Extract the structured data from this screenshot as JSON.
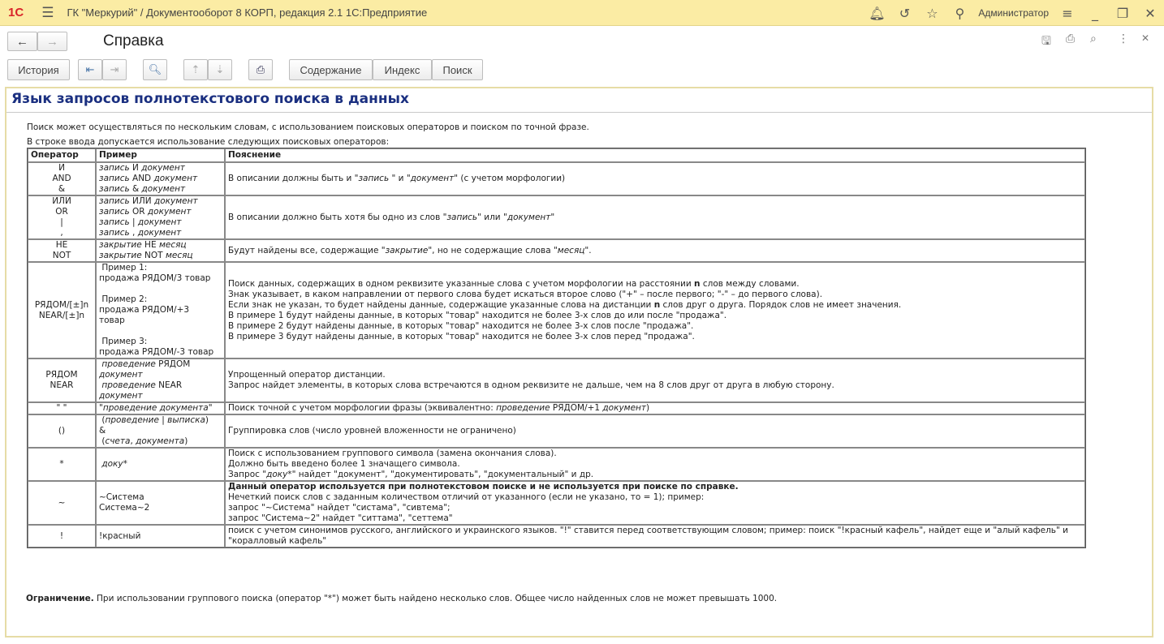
{
  "app": {
    "title": "ГК \"Меркурий\" / Документооборот 8 КОРП, редакция 2.1 1С:Предприятие",
    "logo": "1С",
    "user": "Администратор"
  },
  "window": {
    "title": "Справка"
  },
  "toolbar": {
    "history": "История",
    "contents": "Содержание",
    "index": "Индекс",
    "search": "Поиск"
  },
  "help": {
    "heading": "Язык запросов полнотекстового поиска в данных",
    "intro1": "Поиск может осуществляться по нескольким словам, с использованием поисковых операторов и поиском по точной фразе.",
    "intro2": "В строке ввода допускается использование следующих поисковых операторов:",
    "columns": [
      "Оператор",
      "Пример",
      "Пояснение"
    ],
    "rows": [
      {
        "op": [
          "И",
          "AND",
          "&"
        ],
        "ex": [
          [
            [
              "запись",
              "i"
            ],
            " И ",
            [
              "документ",
              "i"
            ]
          ],
          [
            [
              "запись",
              "i"
            ],
            " AND ",
            [
              "документ",
              "i"
            ]
          ],
          [
            [
              "запись",
              "i"
            ],
            " & ",
            [
              "документ",
              "i"
            ]
          ]
        ],
        "desc": [
          [
            "В описании должны быть и \"",
            [
              "запись ",
              "i"
            ],
            "\" и \"",
            [
              "документ",
              "i"
            ],
            "\" (с учетом морфологии)"
          ]
        ]
      },
      {
        "op": [
          "ИЛИ",
          "OR",
          "|",
          ","
        ],
        "ex": [
          [
            [
              "запись",
              "i"
            ],
            " ИЛИ ",
            [
              "документ",
              "i"
            ]
          ],
          [
            [
              "запись",
              "i"
            ],
            " OR ",
            [
              "документ",
              "i"
            ]
          ],
          [
            [
              "запись",
              "i"
            ],
            " | ",
            [
              "документ",
              "i"
            ]
          ],
          [
            [
              "запись",
              "i"
            ],
            " , ",
            [
              "документ",
              "i"
            ]
          ]
        ],
        "desc": [
          [
            "В описании должно быть хотя бы одно из слов \"",
            [
              "запись",
              "i"
            ],
            "\" или \"",
            [
              "документ",
              "i"
            ],
            "\""
          ]
        ]
      },
      {
        "op": [
          "НЕ",
          "NOT"
        ],
        "ex": [
          [
            [
              "закрытие",
              "i"
            ],
            " НЕ ",
            [
              "месяц",
              "i"
            ]
          ],
          [
            [
              "закрытие",
              "i"
            ],
            " NOT ",
            [
              "месяц",
              "i"
            ]
          ]
        ],
        "desc": [
          [
            "Будут найдены все, содержащие \"",
            [
              "закрытие",
              "i"
            ],
            "\", но не содержащие слова \"",
            [
              "месяц",
              "i"
            ],
            "\"."
          ]
        ]
      },
      {
        "op": [
          "РЯДОМ/[±]n",
          "NEAR/[±]n"
        ],
        "ex": [
          [
            " Пример 1:"
          ],
          [
            "продажа РЯДОМ/3 товар"
          ],
          [
            " "
          ],
          [
            " Пример 2:"
          ],
          [
            "продажа РЯДОМ/+3"
          ],
          [
            "товар"
          ],
          [
            " "
          ],
          [
            " Пример 3:"
          ],
          [
            "продажа РЯДОМ/-3 товар"
          ]
        ],
        "desc": [
          [
            "Поиск данных, содержащих в одном реквизите указанные слова с учетом морфологии на расстоянии ",
            [
              "n",
              "b"
            ],
            " слов между словами."
          ],
          [
            "Знак указывает, в каком направлении от первого слова будет искаться второе слово (\"+\" – после первого; \"-\" – до первого слова)."
          ],
          [
            "Если знак не указан, то будет найдены данные, содержащие указанные слова на дистанции ",
            [
              "n",
              "b"
            ],
            " слов друг о друга. Порядок слов не имеет значения."
          ],
          [
            "В примере 1 будут найдены данные, в которых \"товар\" находится не более 3-х слов до или после \"продажа\"."
          ],
          [
            "В примере 2 будут найдены данные, в которых \"товар\" находится не более 3-х слов после \"продажа\"."
          ],
          [
            "В примере 3 будут найдены данные, в которых \"товар\" находится не более 3-х слов перед \"продажа\"."
          ]
        ]
      },
      {
        "op": [
          "РЯДОМ",
          "NEAR"
        ],
        "ex": [
          [
            " ",
            [
              "проведение",
              "i"
            ],
            " РЯДОМ"
          ],
          [
            [
              "документ",
              "i"
            ]
          ],
          [
            " ",
            [
              "проведение",
              "i"
            ],
            " NEAR"
          ],
          [
            [
              "документ",
              "i"
            ]
          ]
        ],
        "desc": [
          [
            "Упрощенный оператор дистанции."
          ],
          [
            "Запрос найдет элементы, в которых слова встречаются в одном реквизите не дальше, чем на 8 слов друг от друга в любую сторону."
          ]
        ]
      },
      {
        "op": [
          "\" \""
        ],
        "ex": [
          [
            "\"",
            [
              "проведение документа",
              "i"
            ],
            "\""
          ]
        ],
        "desc": [
          [
            "Поиск точной с учетом морфологии фразы (эквивалентно: ",
            [
              "проведение",
              "i"
            ],
            " РЯДОМ/+1 ",
            [
              "документ",
              "i"
            ],
            ")"
          ]
        ]
      },
      {
        "op": [
          "()"
        ],
        "ex": [
          [
            " (",
            [
              "проведение",
              "i"
            ],
            " | ",
            [
              "выписка",
              "i"
            ],
            ")"
          ],
          [
            "&"
          ],
          [
            " (",
            [
              "счета",
              "i"
            ],
            ", ",
            [
              "документа",
              "i"
            ],
            ")"
          ]
        ],
        "desc": [
          [
            "Группировка слов (число уровней вложенности не ограничено)"
          ]
        ]
      },
      {
        "op": [
          "*"
        ],
        "ex": [
          [
            " ",
            [
              "доку*",
              "i"
            ]
          ]
        ],
        "desc": [
          [
            "Поиск с использованием группового символа (замена окончания слова)."
          ],
          [
            "Должно быть введено более 1 значащего символа."
          ],
          [
            "Запрос \"",
            [
              "доку*",
              "i"
            ],
            "\" найдет \"документ\", \"документировать\", \"документальный\" и др."
          ]
        ]
      },
      {
        "op": [
          "~"
        ],
        "ex": [
          [
            "~Система"
          ],
          [
            "Система~2"
          ]
        ],
        "desc": [
          [
            [
              "Данный оператор используется при полнотекстовом поиске и не используется при поиске по справке.",
              "b"
            ]
          ],
          [
            "Нечеткий поиск слов с заданным количеством отличий от указанного (если не указано, то = 1); пример:"
          ],
          [
            "запрос \"~Система\" найдет \"систама\", \"сивтема\";"
          ],
          [
            "запрос \"Система~2\" найдет \"ситтама\", \"сеттема\""
          ]
        ]
      },
      {
        "op": [
          "!"
        ],
        "ex": [
          [
            "!красный"
          ]
        ],
        "desc": [
          [
            "поиск с учетом синонимов русского, английского и украинского языков. \"!\" ставится перед соответствующим словом; пример: поиск \"!красный кафель\", найдет еще и \"алый кафель\" и \"коралловый кафель\""
          ]
        ]
      }
    ],
    "note_label": "Ограничение.",
    "note_text": " При использовании группового поиска (оператор \"*\") может быть найдено несколько слов. Общее число найденных слов не может превышать 1000."
  }
}
